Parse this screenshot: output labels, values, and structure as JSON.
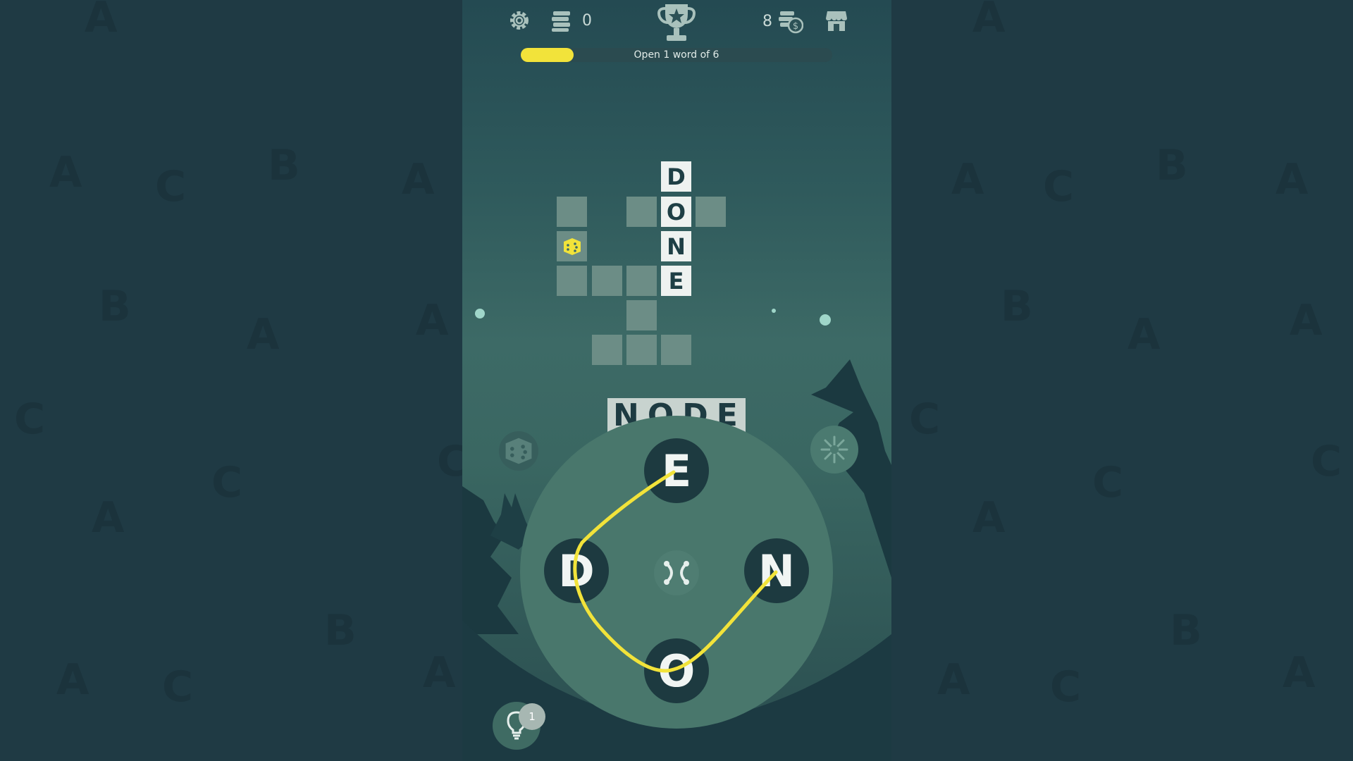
{
  "topbar": {
    "dice_count": "0",
    "coin_count": "8",
    "icons": {
      "settings": "gear-icon",
      "dice_stack": "dice-stack-icon",
      "trophy": "trophy-icon",
      "coins": "coins-icon",
      "shop": "shop-icon"
    }
  },
  "progress": {
    "label": "Open 1 word of 6",
    "fraction": 0.17,
    "fill_color": "#f2e33a"
  },
  "crossword": {
    "revealed_word": "DONE",
    "revealed_letters": [
      "D",
      "O",
      "N",
      "E"
    ],
    "empty_cell_count": 11,
    "bonus_cell": "dice-icon"
  },
  "current_word": "NODE",
  "letter_wheel": {
    "letters": [
      "E",
      "D",
      "N",
      "O"
    ],
    "center_button": "shuffle-icon",
    "swipe_color": "#f2e33a"
  },
  "hint": {
    "count": "1",
    "icon": "lightbulb-icon"
  },
  "powerups": {
    "left": "dice-icon",
    "right": "burst-icon"
  },
  "colors": {
    "accent": "#f2e33a",
    "tile_empty": "#6c8d86",
    "tile_filled": "#eef2f0",
    "page_bg": "#1f3a44"
  }
}
